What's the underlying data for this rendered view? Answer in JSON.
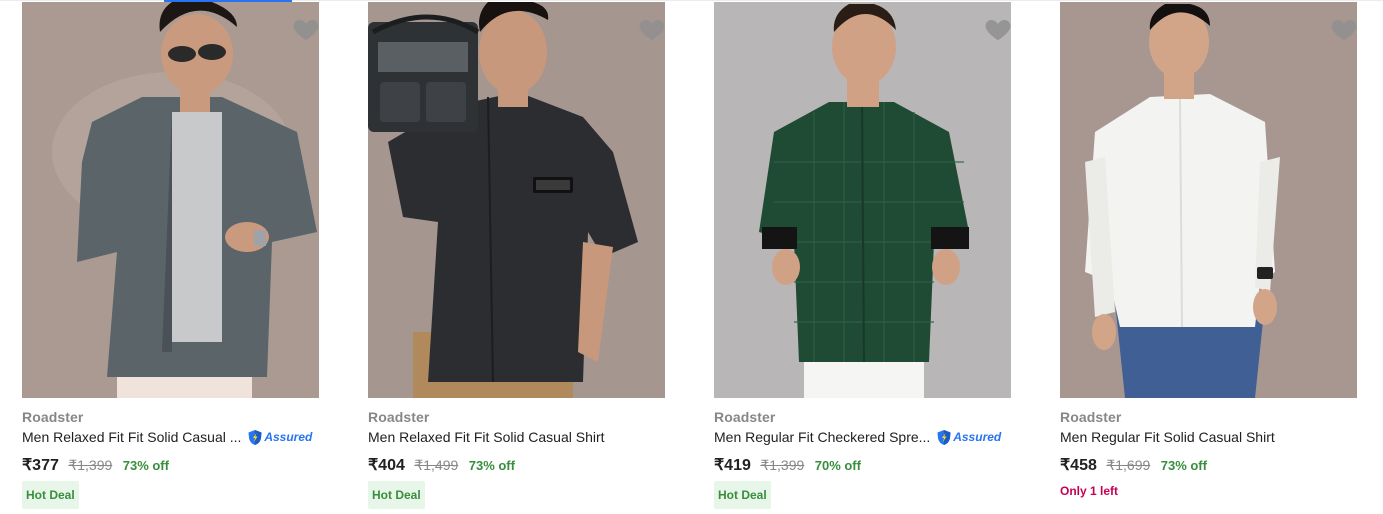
{
  "products": [
    {
      "brand": "Roadster",
      "title": "Men Relaxed Fit Fit Solid Casual ...",
      "assured": true,
      "assured_label": "Assured",
      "price": "₹377",
      "mrp": "₹1,399",
      "discount": "73% off",
      "badge": "Hot Deal",
      "image_alt": "Man in grey half-sleeve shirt with sunglasses",
      "shirt_color": "#5b6469",
      "bg_color": "#aa9a92"
    },
    {
      "brand": "Roadster",
      "title": "Men Relaxed Fit Fit Solid Casual Shirt",
      "assured": false,
      "price": "₹404",
      "mrp": "₹1,499",
      "discount": "73% off",
      "badge": "Hot Deal",
      "image_alt": "Man in black shirt holding a boombox",
      "shirt_color": "#2c2d31",
      "bg_color": "#a69690"
    },
    {
      "brand": "Roadster",
      "title": "Men Regular Fit Checkered Spre...",
      "assured": true,
      "assured_label": "Assured",
      "price": "₹419",
      "mrp": "₹1,399",
      "discount": "70% off",
      "badge": "Hot Deal",
      "image_alt": "Man in dark green checkered shirt",
      "shirt_color": "#1f4a34",
      "bg_color": "#b9b6b7"
    },
    {
      "brand": "Roadster",
      "title": "Men Regular Fit Solid Casual Shirt",
      "assured": false,
      "price": "₹458",
      "mrp": "₹1,699",
      "discount": "73% off",
      "stock_note": "Only 1 left",
      "image_alt": "Man in white shirt and blue jeans",
      "shirt_color": "#f3f3f1",
      "bg_color": "#a89790"
    }
  ],
  "icons": {
    "wishlist": "heart-icon",
    "assured": "assured-shield-icon"
  },
  "colors": {
    "accent": "#2874f0",
    "discount": "#388e3c",
    "hot_deal_bg": "#e8f6ea",
    "stock": "#c70055",
    "brand_text": "#878787"
  }
}
